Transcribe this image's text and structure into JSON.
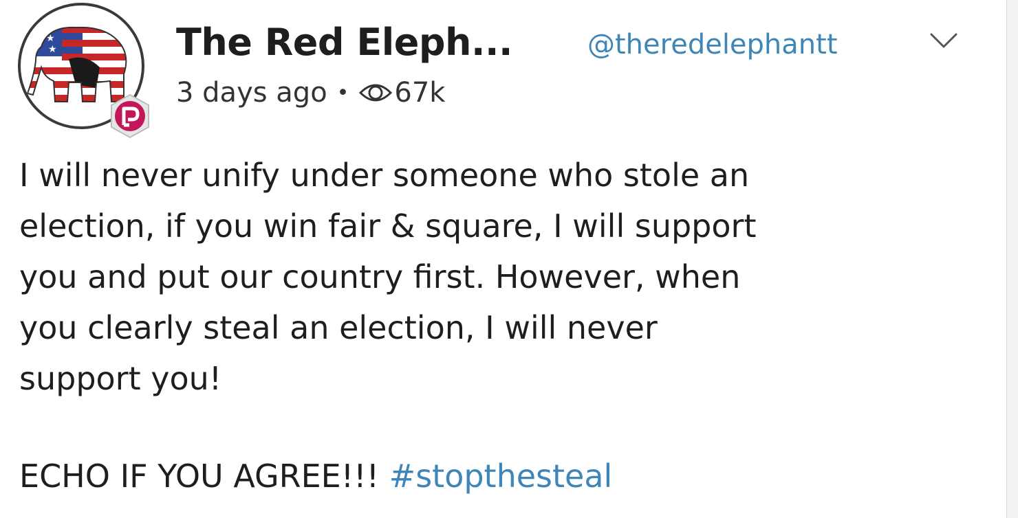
{
  "post": {
    "author_name": "The Red Eleph...",
    "handle": "@theredelephantt",
    "time_ago": "3 days ago",
    "separator": "•",
    "views": "67k",
    "body": "I will never unify under someone who stole an\nelection, if you win fair & square, I will support\nyou and put our country first. However, when\nyou clearly steal an election, I will never\nsupport you!",
    "cta_text": "ECHO IF YOU AGREE!!! ",
    "hashtag": "#stopthesteal"
  },
  "icons": {
    "avatar": "red-elephant-avatar",
    "badge": "parler-badge-icon",
    "views": "eye-icon",
    "menu": "chevron-down-icon"
  },
  "colors": {
    "link": "#3e86b8",
    "badge": "#c2185b",
    "text": "#1e1e1e"
  }
}
